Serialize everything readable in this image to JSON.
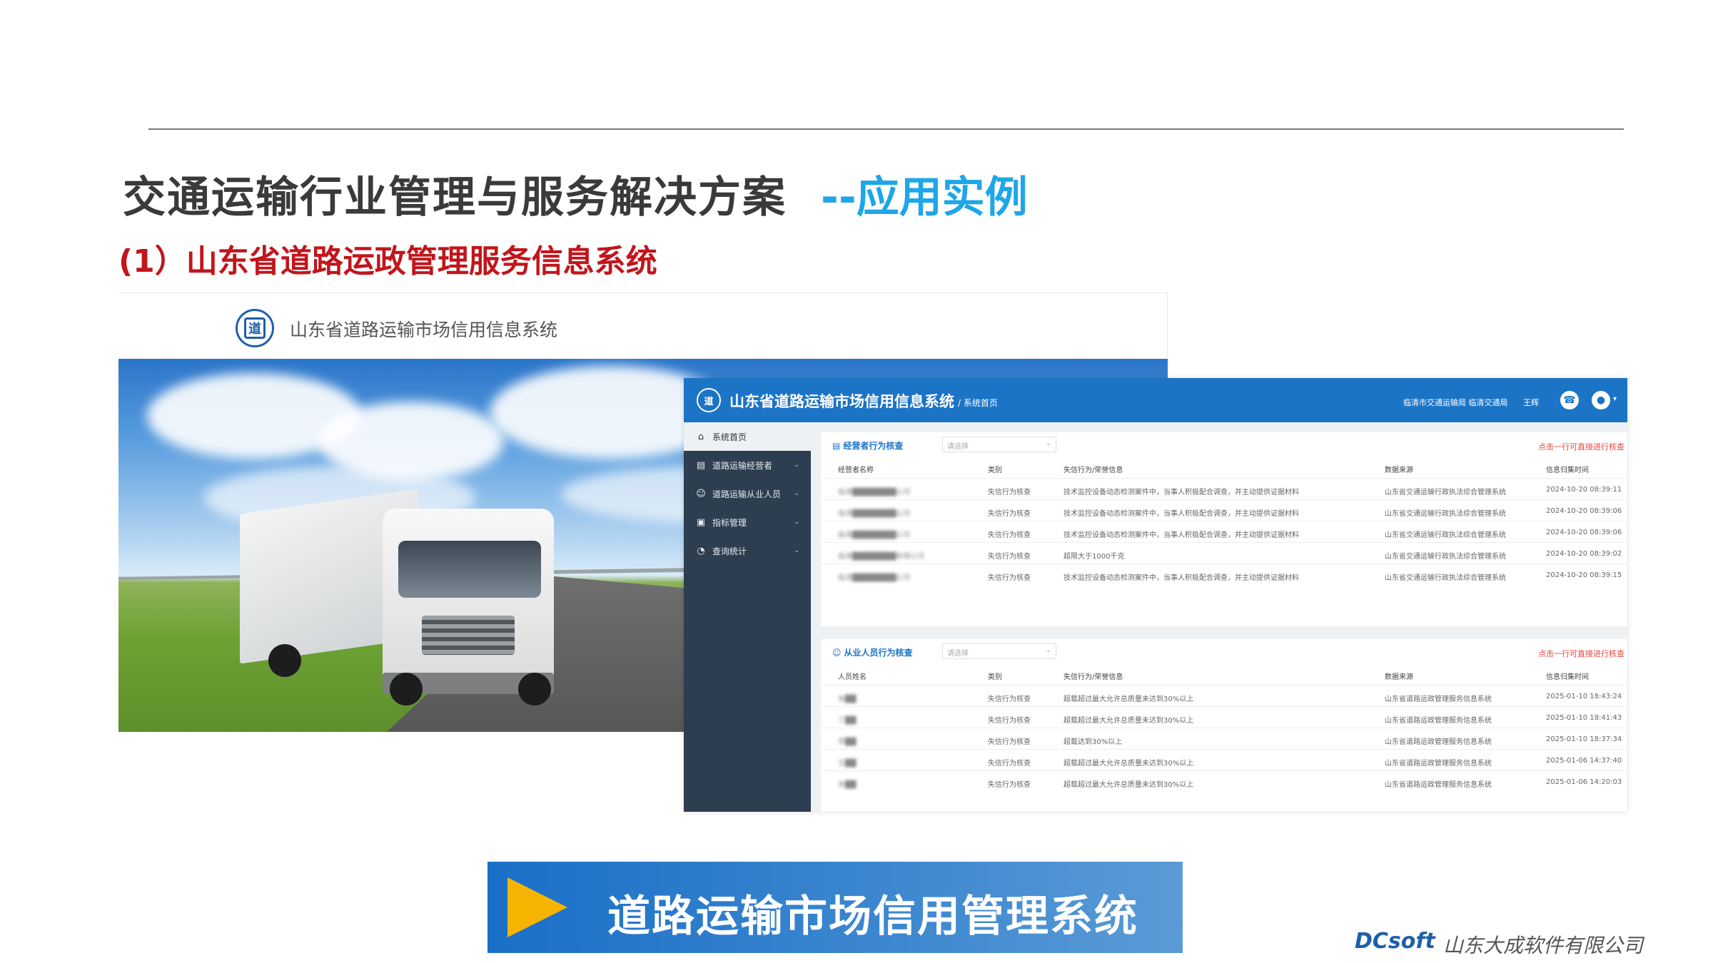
{
  "slide": {
    "title": "交通运输行业管理与服务解决方案",
    "subtitle": "--应用实例",
    "section": "(1）山东省道路运政管理服务信息系统"
  },
  "login_page": {
    "title": "山东省道路运输市场信用信息系统",
    "logo_glyph": "道"
  },
  "dashboard": {
    "title": "山东省道路运输市场信用信息系统",
    "breadcrumb": "/ 系统首页",
    "org": "临清市交通运输局 临清交通局",
    "user": "王辉",
    "logo_glyph": "道",
    "sidebar": [
      {
        "label": "系统首页",
        "icon": "home-icon",
        "glyph": "⌂",
        "active": true,
        "caret": ""
      },
      {
        "label": "道路运输经营者",
        "icon": "building-icon",
        "glyph": "▤",
        "active": false,
        "caret": "⌄"
      },
      {
        "label": "道路运输从业人员",
        "icon": "users-icon",
        "glyph": "☺",
        "active": false,
        "caret": "⌄"
      },
      {
        "label": "指标管理",
        "icon": "list-icon",
        "glyph": "▣",
        "active": false,
        "caret": "⌄"
      },
      {
        "label": "查询统计",
        "icon": "pie-chart-icon",
        "glyph": "◔",
        "active": false,
        "caret": "⌄"
      }
    ],
    "operators": {
      "title": "经营者行为核查",
      "select_placeholder": "请选择",
      "hint": "点击一行可直接进行核查",
      "columns": [
        "经营者名称",
        "类别",
        "失信行为/荣誉信息",
        "数据来源",
        "信息归集时间"
      ],
      "rows": [
        [
          "临清████████公司",
          "失信行为核查",
          "技术监控设备动态检测案件中，当事人积极配合调查，并主动提供证据材料",
          "山东省交通运输行政执法综合管理系统",
          "2024-10-20 08:39:11"
        ],
        [
          "临清████████公司",
          "失信行为核查",
          "技术监控设备动态检测案件中，当事人积极配合调查，并主动提供证据材料",
          "山东省交通运输行政执法综合管理系统",
          "2024-10-20 08:39:06"
        ],
        [
          "临清████████公司",
          "失信行为核查",
          "技术监控设备动态检测案件中，当事人积极配合调查，并主动提供证据材料",
          "山东省交通运输行政执法综合管理系统",
          "2024-10-20 08:39:06"
        ],
        [
          "临清████████有限公司",
          "失信行为核查",
          "超限大于1000千克",
          "山东省交通运输行政执法综合管理系统",
          "2024-10-20 08:39:02"
        ],
        [
          "临清████████公司",
          "失信行为核查",
          "技术监控设备动态检测案件中，当事人积极配合调查，并主动提供证据材料",
          "山东省交通运输行政执法综合管理系统",
          "2024-10-20 08:39:15"
        ]
      ]
    },
    "personnel": {
      "title": "从业人员行为核查",
      "select_placeholder": "请选择",
      "hint": "点击一行可直接进行核查",
      "columns": [
        "人员姓名",
        "类别",
        "失信行为/荣誉信息",
        "数据来源",
        "信息归集时间"
      ],
      "rows": [
        [
          "张██",
          "失信行为核查",
          "超载超过最大允许总质量未达到30%以上",
          "山东省道路运政管理服务信息系统",
          "2025-01-10 18:43:24"
        ],
        [
          "丁██",
          "失信行为核查",
          "超载超过最大允许总质量未达到30%以上",
          "山东省道路运政管理服务信息系统",
          "2025-01-10 18:41:43"
        ],
        [
          "李██",
          "失信行为核查",
          "超载达到30%以上",
          "山东省道路运政管理服务信息系统",
          "2025-01-10 18:37:34"
        ],
        [
          "王██",
          "失信行为核查",
          "超载超过最大允许总质量未达到30%以上",
          "山东省道路运政管理服务信息系统",
          "2025-01-06 14:37:40"
        ],
        [
          "朱██",
          "失信行为核查",
          "超载超过最大允许总质量未达到30%以上",
          "山东省道路运政管理服务信息系统",
          "2025-01-06 14:20:03"
        ]
      ]
    }
  },
  "banner": {
    "label": "道路运输市场信用管理系统",
    "icon": "play-icon"
  },
  "footer": {
    "brand_logo": "DCsoft",
    "company": "山东大成软件有限公司"
  },
  "colors": {
    "title": "#3a3a3a",
    "subtitle": "#1ea6e8",
    "section": "#c0161c",
    "header": "#1c74c6",
    "sidebar": "#2d3e50",
    "banner": "#1a6fc8",
    "play": "#f5b400"
  }
}
